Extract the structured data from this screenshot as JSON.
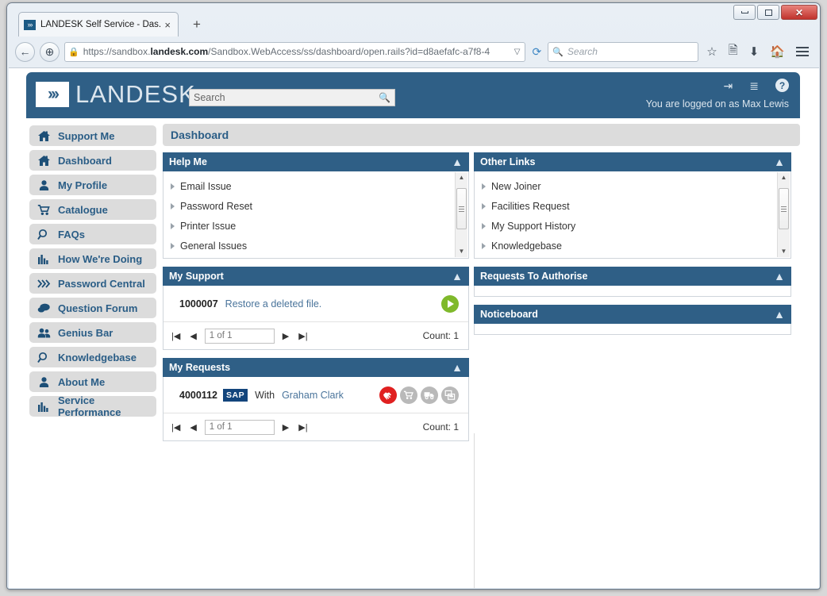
{
  "browser": {
    "tab": {
      "title": "LANDESK Self Service - Das...",
      "favicon_icon": "landesk-chevrons-icon",
      "close_icon": "×"
    },
    "new_tab_label": "+",
    "window_controls": {
      "minimize": "minimize-icon",
      "maximize": "restore-icon",
      "close": "✕"
    },
    "nav": {
      "back_icon": "←",
      "tracking_icon": "⊕",
      "lock_icon": "🔒",
      "url_scheme": "https://sandbox.",
      "url_domain": "landesk.com",
      "url_path": "/Sandbox.WebAccess/ss/dashboard/open.rails?id=d8aefafc-a7f8-4",
      "dropdown_icon": "▽",
      "reload_icon": "⟳",
      "search_placeholder": "Search",
      "search_icon": "search-icon",
      "bookmark_icon": "☆",
      "reader_icon": "reader-icon",
      "download_icon": "⬇",
      "home_icon": "home-icon",
      "menu_icon": "hamburger-icon"
    }
  },
  "banner": {
    "logo_mark": "›››",
    "logo_text": "LANDESK",
    "search_placeholder": "Search",
    "search_icon": "search-icon",
    "icons": [
      {
        "name": "logout-icon",
        "glyph": "⇥"
      },
      {
        "name": "list-icon",
        "glyph": "☰"
      },
      {
        "name": "help-icon",
        "glyph": "?"
      }
    ],
    "logged_on_text": "You are logged on as Max Lewis"
  },
  "sidebar": {
    "items": [
      {
        "label": "Support Me",
        "icon": "home-icon"
      },
      {
        "label": "Dashboard",
        "icon": "home-icon"
      },
      {
        "label": "My Profile",
        "icon": "person-icon"
      },
      {
        "label": "Catalogue",
        "icon": "cart-icon"
      },
      {
        "label": "FAQs",
        "icon": "magnifier-icon"
      },
      {
        "label": "How We're Doing",
        "icon": "bar-chart-icon"
      },
      {
        "label": "Password Central",
        "icon": "chevrons-icon"
      },
      {
        "label": "Question Forum",
        "icon": "speech-bubble-icon"
      },
      {
        "label": "Genius Bar",
        "icon": "people-icon"
      },
      {
        "label": "Knowledgebase",
        "icon": "magnifier-icon"
      },
      {
        "label": "About Me",
        "icon": "person-icon"
      },
      {
        "label": "Service Performance",
        "icon": "bar-chart-icon"
      }
    ]
  },
  "page": {
    "title": "Dashboard"
  },
  "panels": {
    "help_me": {
      "title": "Help Me",
      "collapse_icon": "⌃",
      "items": [
        {
          "label": "Email Issue"
        },
        {
          "label": "Password Reset"
        },
        {
          "label": "Printer Issue"
        },
        {
          "label": "General Issues"
        }
      ]
    },
    "other_links": {
      "title": "Other Links",
      "collapse_icon": "⌃",
      "items": [
        {
          "label": "New Joiner"
        },
        {
          "label": "Facilities Request"
        },
        {
          "label": "My Support History"
        },
        {
          "label": "Knowledgebase"
        }
      ]
    },
    "my_support": {
      "title": "My Support",
      "collapse_icon": "⌃",
      "row": {
        "id": "1000007",
        "link": "Restore a deleted file.",
        "action_icon": "play-icon"
      },
      "pager": {
        "first_icon": "|◀",
        "prev_icon": "◀",
        "value": "1 of 1",
        "next_icon": "▶",
        "last_icon": "▶|",
        "count_label": "Count: 1"
      }
    },
    "my_requests": {
      "title": "My Requests",
      "collapse_icon": "⌃",
      "row": {
        "id": "4000112",
        "badge": "SAP",
        "with_label": "With",
        "assignee": "Graham Clark",
        "status_icons": [
          {
            "name": "handshake-icon",
            "state": "active"
          },
          {
            "name": "cart-icon",
            "state": "inactive"
          },
          {
            "name": "truck-icon",
            "state": "inactive"
          },
          {
            "name": "copy-icon",
            "state": "inactive"
          }
        ]
      },
      "pager": {
        "first_icon": "|◀",
        "prev_icon": "◀",
        "value": "1 of 1",
        "next_icon": "▶",
        "last_icon": "▶|",
        "count_label": "Count: 1"
      }
    },
    "requests_to_authorise": {
      "title": "Requests To Authorise",
      "collapse_icon": "⌃"
    },
    "noticeboard": {
      "title": "Noticeboard",
      "collapse_icon": "⌃"
    }
  },
  "colors": {
    "brand_blue": "#2f5f86",
    "sidebar_grey": "#dcdcdc",
    "link_blue": "#4a749b",
    "play_green": "#7fb92b",
    "status_red": "#e02020",
    "sap_navy": "#13457c"
  }
}
